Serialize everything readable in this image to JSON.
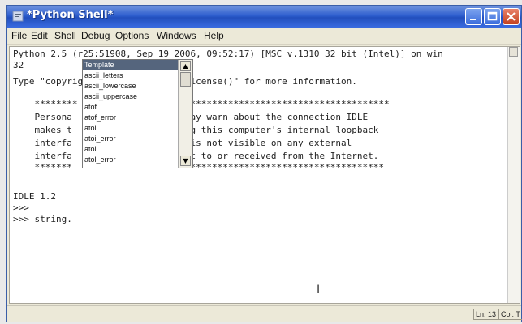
{
  "window": {
    "title": "*Python Shell*"
  },
  "menubar": {
    "items": [
      "File",
      "Edit",
      "Shell",
      "Debug",
      "Options",
      "Windows",
      "Help"
    ]
  },
  "editor": {
    "lines": [
      "Python 2.5 (r25:51908, Sep 19 2006, 09:52:17) [MSC v.1310 32 bit (Intel)] on win",
      "32",
      "Type \"copyright\", \"credits\" or \"license()\" for more information.",
      "",
      "    ********                   ***************************************",
      "    Persona                   e may warn about the connection IDLE",
      "    makes t                   sing this computer's internal loopback",
      "    interfa                   on is not visible on any external",
      "    interfa                   sent to or received from the Internet.",
      "    *******                   ***************************************",
      "",
      "IDLE 1.2",
      ">>>",
      ">>> string."
    ]
  },
  "completion": {
    "items": [
      "Template",
      "ascii_letters",
      "ascii_lowercase",
      "ascii_uppercase",
      "atof",
      "atof_error",
      "atoi",
      "atoi_error",
      "atol",
      "atol_error"
    ],
    "selected_index": 0
  },
  "statusbar": {
    "line": "Ln: 13",
    "col": "Col: T"
  }
}
